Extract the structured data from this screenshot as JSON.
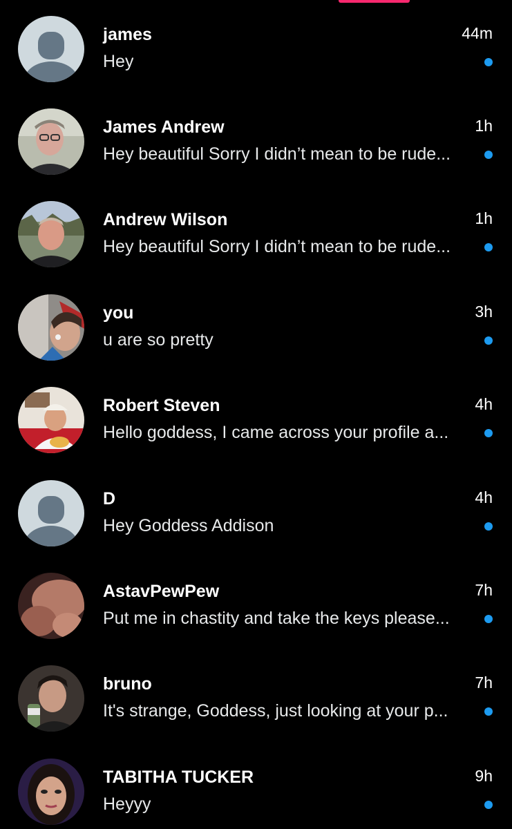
{
  "colors": {
    "background": "#000000",
    "accent_tab": "#f7286e",
    "unread_dot": "#1d9bf0",
    "default_avatar_bg": "#cfd9de",
    "default_avatar_fg": "#657786"
  },
  "conversations": [
    {
      "name": "james",
      "time": "44m",
      "preview": "Hey",
      "unread": true,
      "avatar": "default-avatar"
    },
    {
      "name": "James Andrew",
      "time": "1h",
      "preview": "Hey beautiful Sorry I didn’t mean to be rude...",
      "unread": true,
      "avatar": "photo-avatar"
    },
    {
      "name": "Andrew Wilson",
      "time": "1h",
      "preview": "Hey beautiful Sorry I didn’t mean to be rude...",
      "unread": true,
      "avatar": "photo-avatar"
    },
    {
      "name": "you",
      "time": "3h",
      "preview": "u are so pretty",
      "unread": true,
      "avatar": "photo-avatar"
    },
    {
      "name": "Robert Steven",
      "time": "4h",
      "preview": "Hello goddess, I came across your profile a...",
      "unread": true,
      "avatar": "photo-avatar"
    },
    {
      "name": "D",
      "time": "4h",
      "preview": "Hey Goddess Addison",
      "unread": true,
      "avatar": "default-avatar"
    },
    {
      "name": "AstavPewPew",
      "time": "7h",
      "preview": "Put me in chastity and take the keys please...",
      "unread": true,
      "avatar": "photo-avatar"
    },
    {
      "name": "bruno",
      "time": "7h",
      "preview": "It's strange, Goddess, just looking at your p...",
      "unread": true,
      "avatar": "photo-avatar"
    },
    {
      "name": "TABITHA TUCKER",
      "time": "9h",
      "preview": "Heyyy",
      "unread": true,
      "avatar": "photo-avatar"
    }
  ]
}
